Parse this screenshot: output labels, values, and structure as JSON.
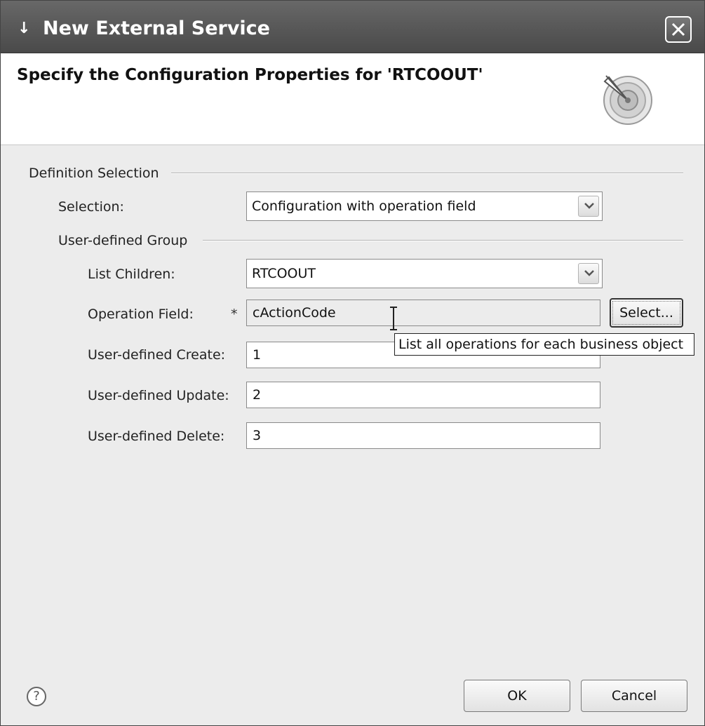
{
  "window": {
    "title": "New External Service"
  },
  "banner": {
    "heading": "Specify the Configuration Properties for 'RTCOOUT'"
  },
  "definition_section": {
    "label": "Definition Selection",
    "selection_label": "Selection:",
    "selection_value": "Configuration with operation field"
  },
  "user_group": {
    "label": "User-defined Group",
    "list_children_label": "List Children:",
    "list_children_value": "RTCOOUT",
    "operation_field_label": "Operation Field:",
    "operation_field_required": "*",
    "operation_field_value": "cActionCode",
    "select_button": "Select...",
    "tooltip": "List all operations for each business object",
    "create_label": "User-defined Create:",
    "create_value": "1",
    "update_label": "User-defined Update:",
    "update_value": "2",
    "delete_label": "User-defined Delete:",
    "delete_value": "3"
  },
  "footer": {
    "help_glyph": "?",
    "ok_label": "OK",
    "cancel_label": "Cancel"
  }
}
